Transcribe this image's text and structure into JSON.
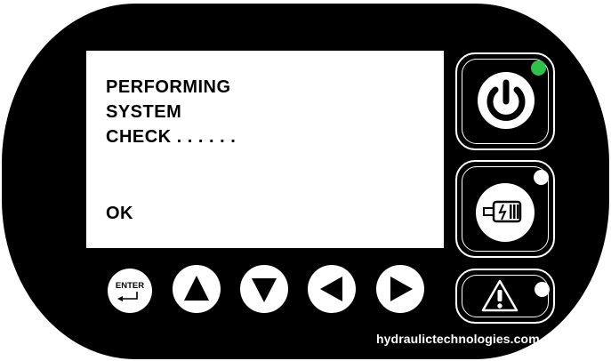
{
  "screen": {
    "lines": [
      "PERFORMING",
      "SYSTEM",
      "CHECK . . . . . ."
    ],
    "status": "OK"
  },
  "buttons": {
    "enter_label": "ENTER",
    "power_icon": "power-icon",
    "motor_icon": "motor-icon",
    "warning_icon": "warning-icon",
    "up_icon": "triangle-up-icon",
    "down_icon": "triangle-down-icon",
    "left_icon": "triangle-left-icon",
    "right_icon": "triangle-right-icon"
  },
  "leds": {
    "power": "#2fc24a",
    "motor": "#ffffff",
    "warning": "#ffffff"
  },
  "brand": "hydraulictechnologies.com"
}
